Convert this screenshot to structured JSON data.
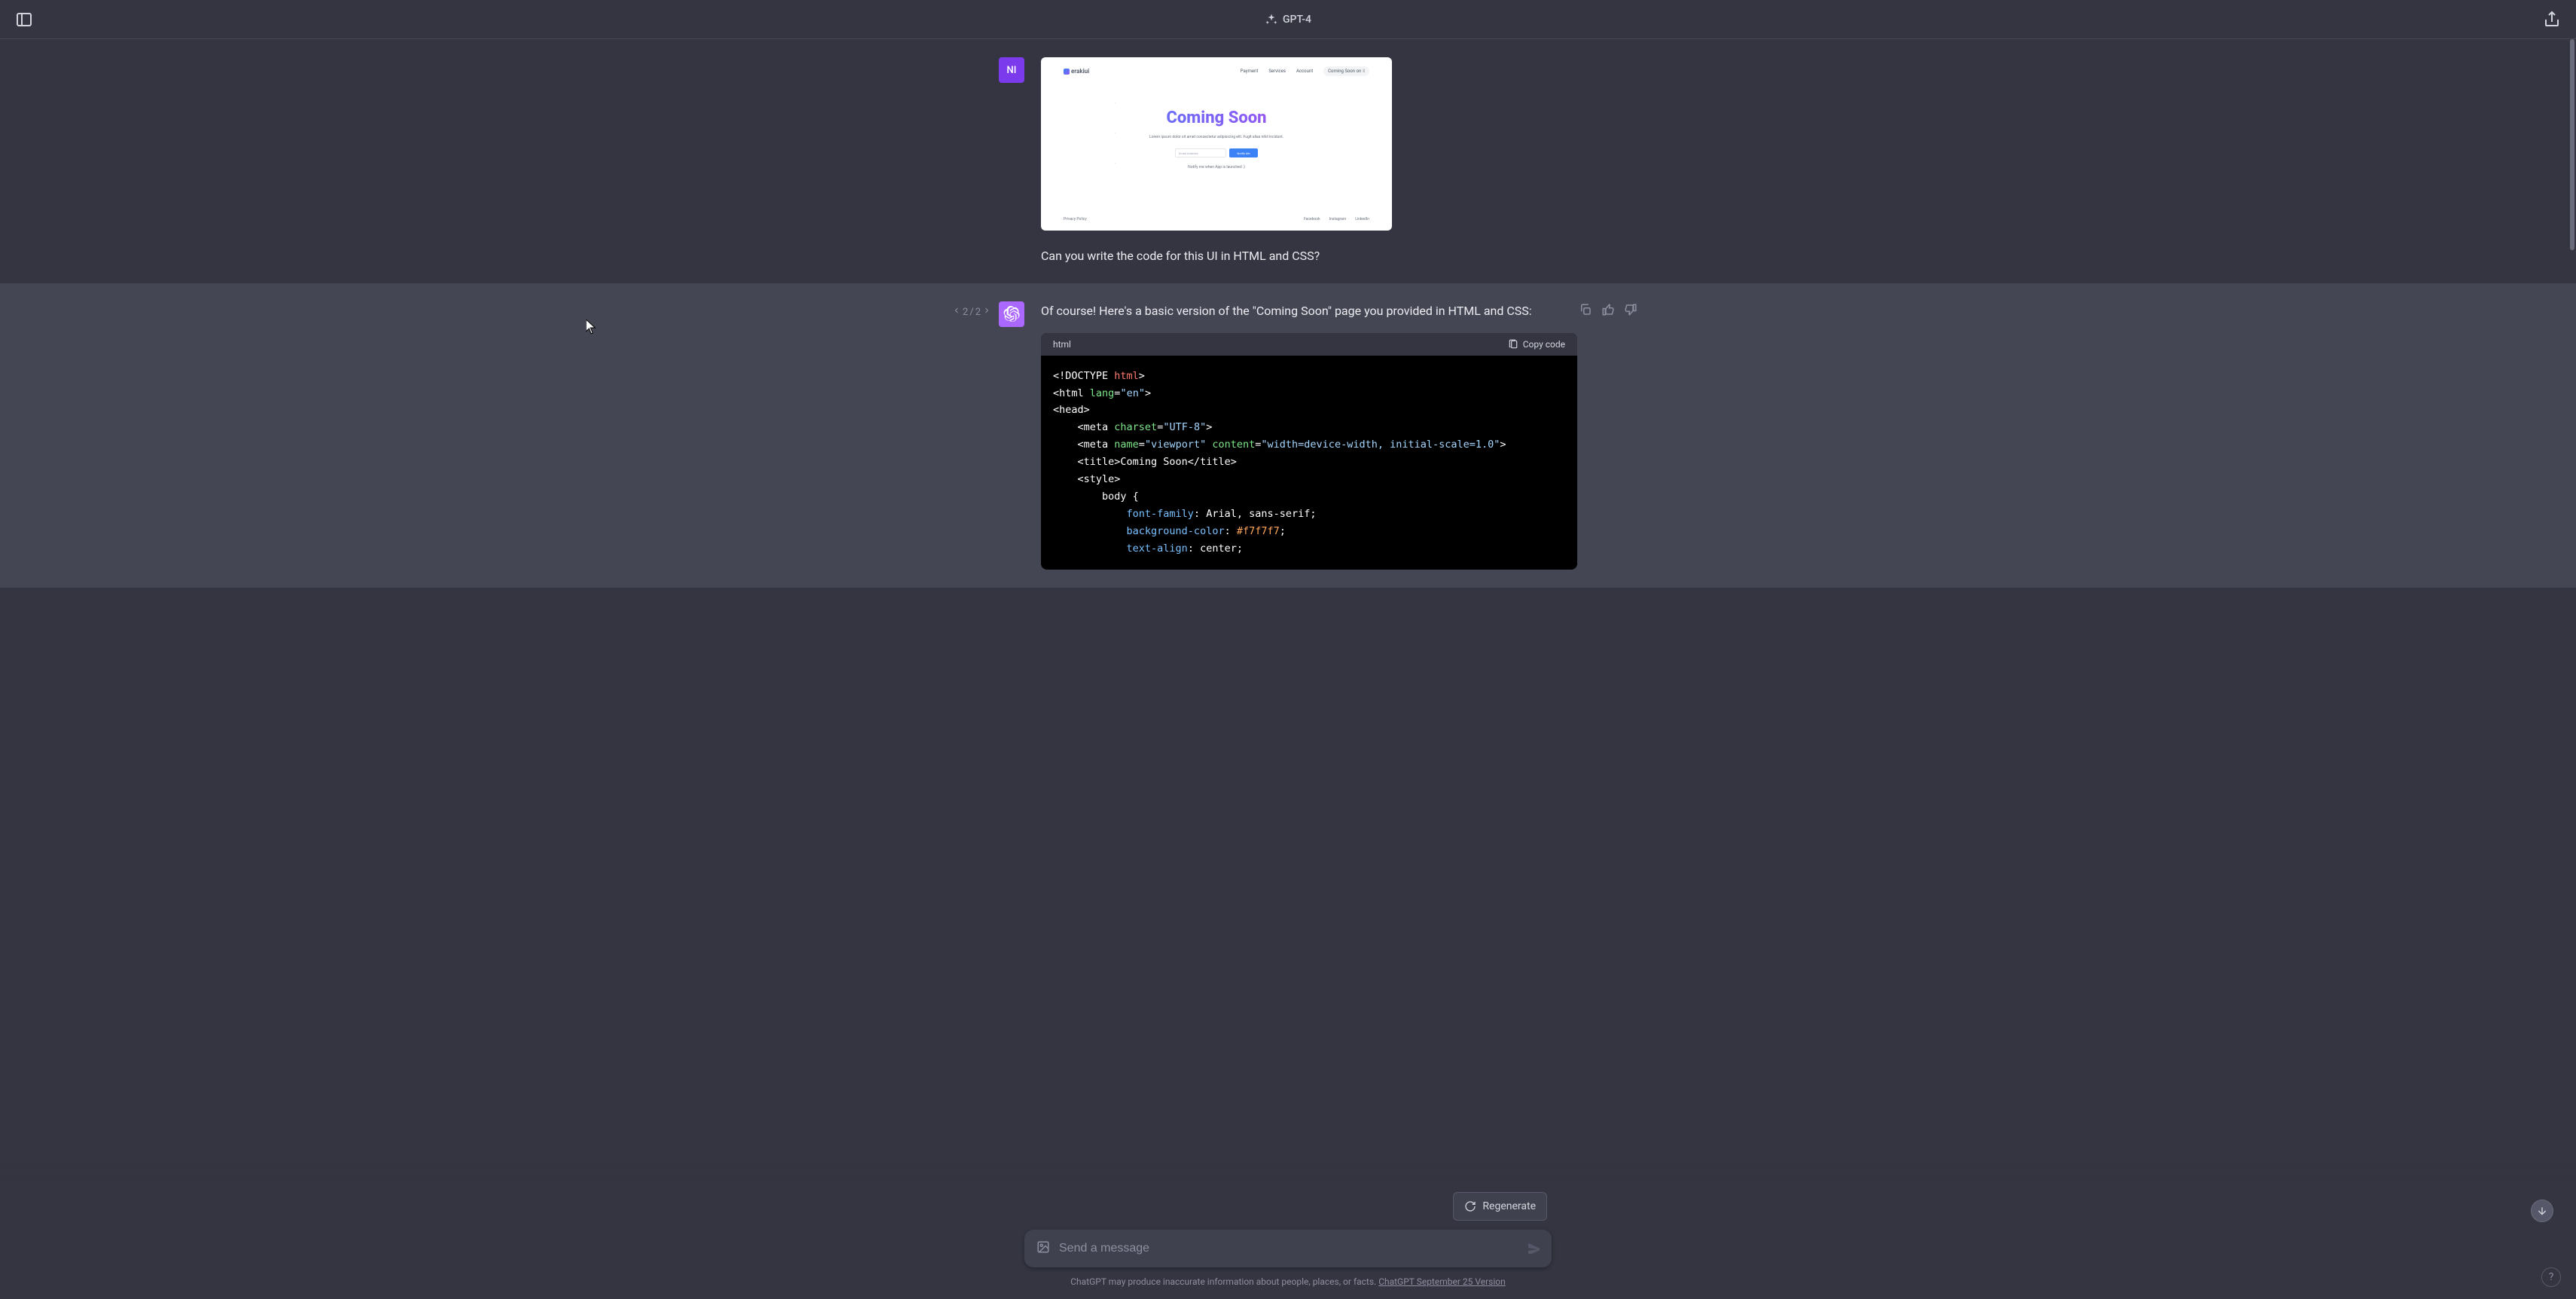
{
  "header": {
    "model": "GPT-4"
  },
  "user_message": {
    "avatar_initials": "NI",
    "question": "Can you write the code for this UI in HTML and CSS?",
    "preview": {
      "logo": "erakiui",
      "nav": [
        "Payment",
        "Services",
        "Account"
      ],
      "pill": "Coming Soon on",
      "hero_title": "Coming Soon",
      "hero_sub": "Lorem ipsum dolor sit amet consectetur adipisicing elit. Fugit alias nihil incidunt.",
      "email_placeholder": "Email Address",
      "notify_btn": "Notify Me",
      "note": "Notify me when App is launched :)",
      "privacy": "Privacy Policy",
      "social": [
        "Facebook",
        "Instagram",
        "LinkedIn"
      ]
    }
  },
  "nav_counter": {
    "current": "2",
    "sep": "/",
    "total": "2"
  },
  "assistant_message": {
    "intro": "Of course! Here's a basic version of the \"Coming Soon\" page you provided in HTML and CSS:",
    "code_lang": "html",
    "copy_label": "Copy code",
    "code": {
      "l1_doctype": "<!DOCTYPE ",
      "l1_html": "html",
      "l1_gt": ">",
      "l2_open": "<html ",
      "l2_attr": "lang",
      "l2_eq": "=",
      "l2_val": "\"en\"",
      "l2_gt": ">",
      "l3": "<head>",
      "l4_open": "    <meta ",
      "l4_attr": "charset",
      "l4_eq": "=",
      "l4_val": "\"UTF-8\"",
      "l4_gt": ">",
      "l5_open": "    <meta ",
      "l5_attr1": "name",
      "l5_eq1": "=",
      "l5_val1": "\"viewport\"",
      "l5_sp": " ",
      "l5_attr2": "content",
      "l5_eq2": "=",
      "l5_val2": "\"width=device-width, initial-scale=1.0\"",
      "l5_gt": ">",
      "l6": "    <title>Coming Soon</title>",
      "l7": "    <style>",
      "l8": "        body {",
      "l9_prop": "            font-family",
      "l9_val": ": Arial, sans-serif;",
      "l10_prop": "            background-color",
      "l10_val_a": ": ",
      "l10_val_b": "#f7f7f7",
      "l10_val_c": ";",
      "l11_prop": "            text-align",
      "l11_val": ": center;"
    }
  },
  "regenerate": "Regenerate",
  "input": {
    "placeholder": "Send a message"
  },
  "disclaimer": {
    "text_a": "ChatGPT may produce inaccurate information about people, places, or facts. ",
    "link": "ChatGPT September 25 Version"
  },
  "help": "?"
}
